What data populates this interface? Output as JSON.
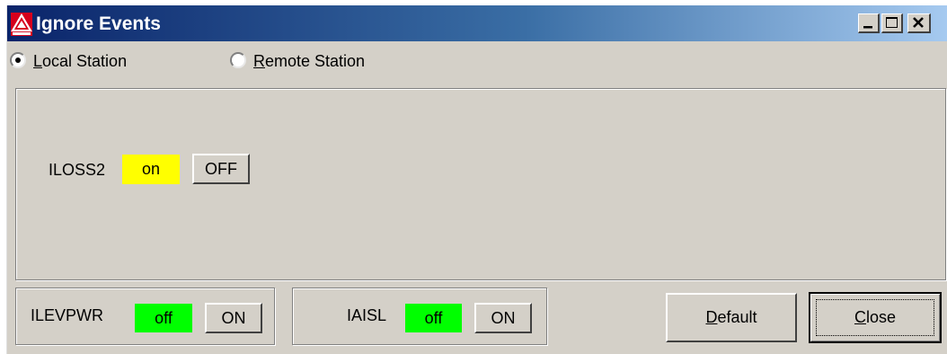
{
  "window": {
    "title": "Ignore Events",
    "icon": "loop-triangle-icon",
    "controls": [
      "minimize",
      "maximize",
      "close"
    ]
  },
  "station_selector": {
    "options": [
      {
        "label": "Local Station",
        "mnemonic": "L",
        "rest": "ocal Station",
        "selected": true
      },
      {
        "label": "Remote Station",
        "mnemonic": "R",
        "rest": "emote Station",
        "selected": false
      }
    ]
  },
  "events": {
    "iloss2": {
      "name": "ILOSS2",
      "state": "on",
      "state_color": "#ffff00",
      "toggle_label": "OFF"
    },
    "ilevpwr": {
      "name": "ILEVPWR",
      "state": "off",
      "state_color": "#00ff00",
      "toggle_label": "ON"
    },
    "iaisl": {
      "name": "IAISL",
      "state": "off",
      "state_color": "#00ff00",
      "toggle_label": "ON"
    }
  },
  "actions": {
    "default": {
      "label": "Default",
      "mnemonic": "D",
      "rest": "efault"
    },
    "close": {
      "label": "Close",
      "mnemonic": "C",
      "rest": "lose"
    }
  },
  "colors": {
    "titlebar_start": "#0a246a",
    "titlebar_end": "#a6caf0",
    "face": "#d4d0c8"
  }
}
